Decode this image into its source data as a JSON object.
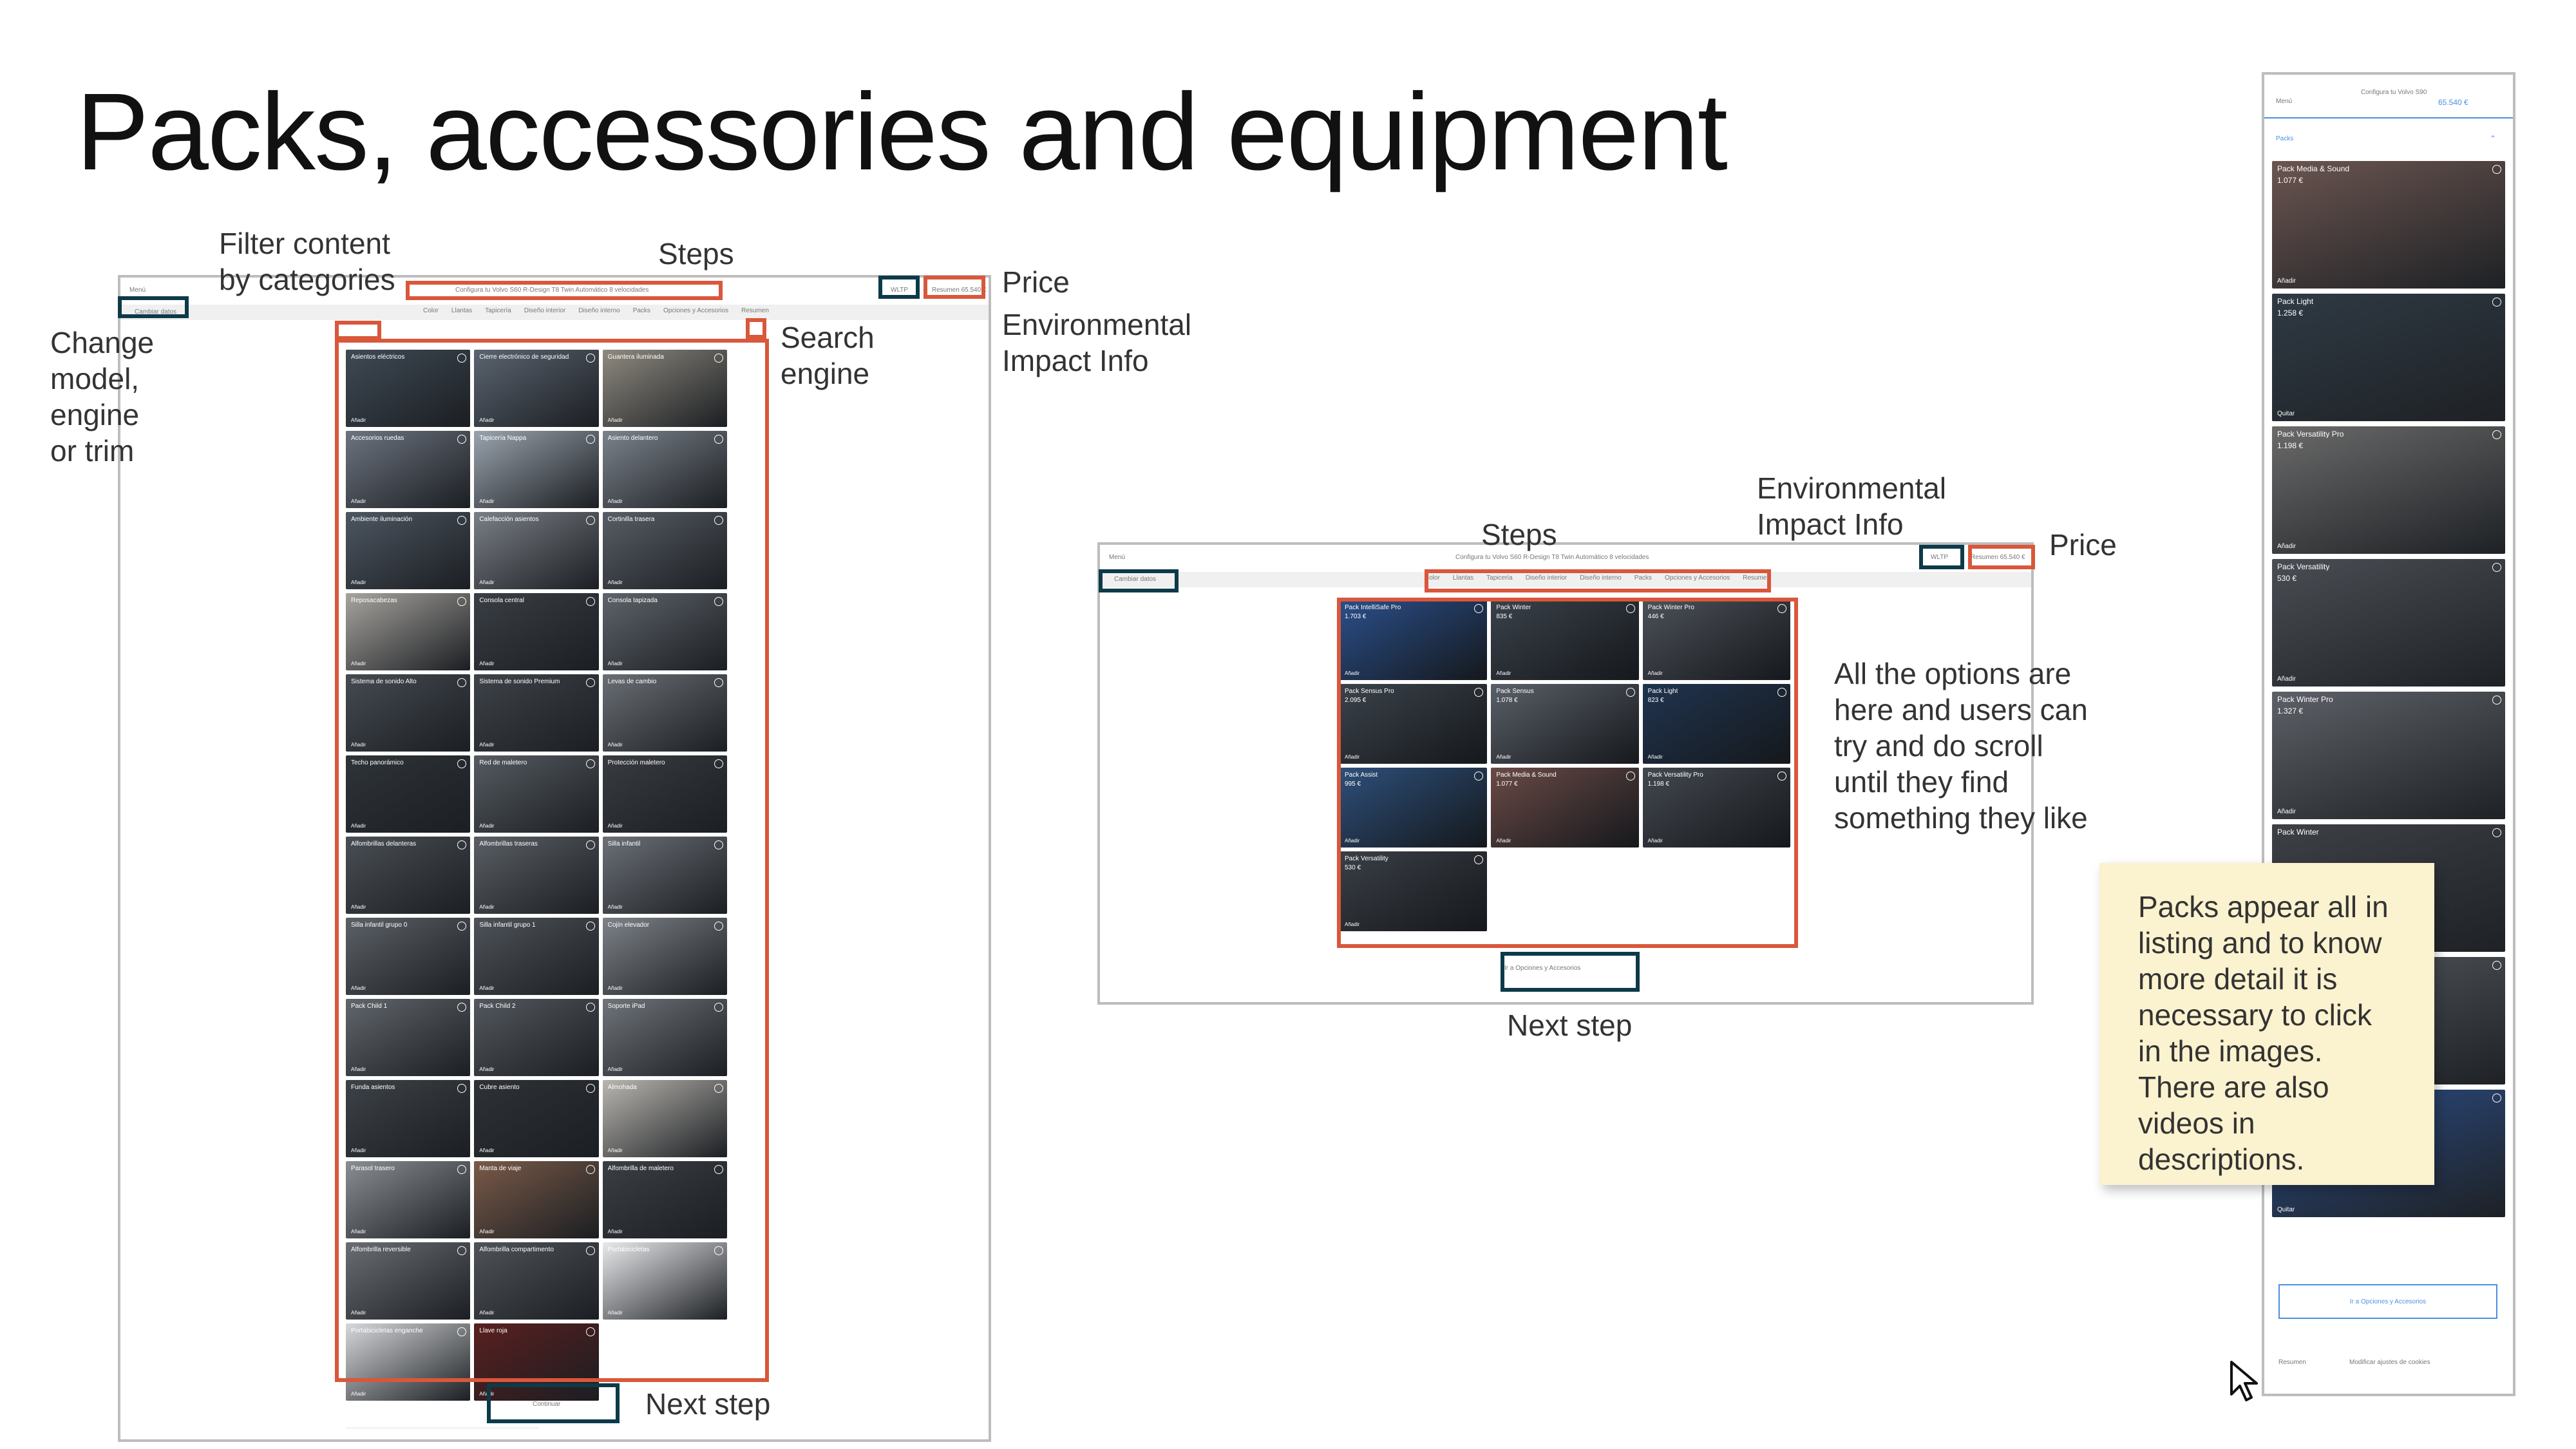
{
  "slide_title": "Packs, accessories and equipment",
  "annotations": {
    "filter": "Filter content\nby categories",
    "steps_left": "Steps",
    "price_left": "Price",
    "env_left": "Environmental\nImpact Info",
    "change_model": "Change\nmodel,\nengine\nor trim",
    "search": "Search\nengine",
    "next_left": "Next step",
    "steps_mid": "Steps",
    "env_mid": "Environmental\nImpact Info",
    "price_mid": "Price",
    "options_note": "All the options are\nhere and users can\ntry and do scroll\nuntil they find\nsomething they like",
    "next_mid": "Next step"
  },
  "sticky_note": "Packs appear all in listing and to know more detail it is necessary to click in the images. There are also videos in descriptions.",
  "desktop_left": {
    "header_menu": "Menú",
    "header_title": "Configura tu Volvo S60 R-Design T8 Twin Automático 8 velocidades",
    "model_button": "Cambiar datos",
    "steps": [
      "Color",
      "Llantas",
      "Tapicería",
      "Diseño interior",
      "Diseño interno",
      "Packs",
      "Opciones y Accesorios",
      "Resumen"
    ],
    "env_button": "WLTP",
    "price_button": "Resumen 65.540 €",
    "next_button": "Continuar",
    "add_label": "Añadir",
    "tiles": [
      {
        "name": "Asientos eléctricos",
        "color": "#3f4a55"
      },
      {
        "name": "Cierre electrónico de seguridad",
        "color": "#5b6470"
      },
      {
        "name": "Guantera iluminada",
        "color": "#8f8a80"
      },
      {
        "name": "Accesorios ruedas",
        "color": "#6d7480"
      },
      {
        "name": "Tapicería Nappa",
        "color": "#9aa3ad"
      },
      {
        "name": "Asiento delantero",
        "color": "#7c838c"
      },
      {
        "name": "Ambiente iluminación",
        "color": "#4d5661"
      },
      {
        "name": "Calefacción asientos",
        "color": "#7a7f86"
      },
      {
        "name": "Cortinilla trasera",
        "color": "#585e66"
      },
      {
        "name": "Reposacabezas",
        "color": "#a7a49f"
      },
      {
        "name": "Consola central",
        "color": "#3a3f45"
      },
      {
        "name": "Consola tapizada",
        "color": "#5e646b"
      },
      {
        "name": "Sistema de sonido Alto",
        "color": "#454b52"
      },
      {
        "name": "Sistema de sonido Premium",
        "color": "#3e4349"
      },
      {
        "name": "Levas de cambio",
        "color": "#6a6f75"
      },
      {
        "name": "Techo panorámico",
        "color": "#2f3439"
      },
      {
        "name": "Red de maletero",
        "color": "#555b61"
      },
      {
        "name": "Protección maletero",
        "color": "#383c41"
      },
      {
        "name": "Alfombrillas delanteras",
        "color": "#4a4f55"
      },
      {
        "name": "Alfombrillas traseras",
        "color": "#5a5f65"
      },
      {
        "name": "Silla infantil",
        "color": "#6b7077"
      },
      {
        "name": "Silla infantil grupo 0",
        "color": "#5c6167"
      },
      {
        "name": "Silla infantil grupo 1",
        "color": "#4e5359"
      },
      {
        "name": "Cojín elevador",
        "color": "#7d8288"
      },
      {
        "name": "Pack Child 1",
        "color": "#61666c"
      },
      {
        "name": "Pack Child 2",
        "color": "#53585e"
      },
      {
        "name": "Soporte iPad",
        "color": "#6f747a"
      },
      {
        "name": "Funda asientos",
        "color": "#3d4248"
      },
      {
        "name": "Cubre asiento",
        "color": "#2e3237"
      },
      {
        "name": "Almohada",
        "color": "#b9b6b0"
      },
      {
        "name": "Parasol trasero",
        "color": "#8a8e93"
      },
      {
        "name": "Manta de viaje",
        "color": "#7a5a48"
      },
      {
        "name": "Alfombrilla de maletero",
        "color": "#3b3f44"
      },
      {
        "name": "Alfombrilla reversible",
        "color": "#6a6e73"
      },
      {
        "name": "Alfombrilla compartimento",
        "color": "#4f5358"
      },
      {
        "name": "Portabicicletas",
        "color": "#e9eaec"
      },
      {
        "name": "Portabicicletas enganche",
        "color": "#d6d8db"
      },
      {
        "name": "Llave roja",
        "color": "#5a1f1f"
      }
    ]
  },
  "desktop_mid": {
    "header_menu": "Menú",
    "header_title": "Configura tu Volvo S60 R-Design T8 Twin Automático 8 velocidades",
    "model_button": "Cambiar datos",
    "steps": [
      "Color",
      "Llantas",
      "Tapicería",
      "Diseño interior",
      "Diseño interno",
      "Packs",
      "Opciones y Accesorios",
      "Resumen"
    ],
    "env_button": "WLTP",
    "price_button": "Resumen 65.540 €",
    "next_button": "Ir a Opciones y Accesorios",
    "add_label": "Añadir",
    "tiles": [
      {
        "name": "Pack IntelliSafe Pro",
        "price": "1.703 €",
        "color": "#2a4f8a"
      },
      {
        "name": "Pack Winter",
        "price": "835 €",
        "color": "#3a4149"
      },
      {
        "name": "Pack Winter Pro",
        "price": "446 €",
        "color": "#4c5158"
      },
      {
        "name": "Pack Sensus Pro",
        "price": "2.095 €",
        "color": "#3b424a"
      },
      {
        "name": "Pack Sensus",
        "price": "1.078 €",
        "color": "#5a6068"
      },
      {
        "name": "Pack Light",
        "price": "823 €",
        "color": "#20344f"
      },
      {
        "name": "Pack Assist",
        "price": "995 €",
        "color": "#2d4f7a"
      },
      {
        "name": "Pack Media & Sound",
        "price": "1.077 €",
        "color": "#6a4a46"
      },
      {
        "name": "Pack Versatility Pro",
        "price": "1.198 €",
        "color": "#43484f"
      },
      {
        "name": "Pack Versatility",
        "price": "530 €",
        "color": "#3a3f46"
      }
    ]
  },
  "mobile": {
    "menu": "Menú",
    "title": "Configura tu Volvo S90",
    "price": "65.540 €",
    "category": "Packs",
    "add_label": "Añadir",
    "remove_label": "Quitar",
    "next_button": "Ir a Opciones y Accesorios",
    "footer_left": "Resumen",
    "footer_right": "Modificar ajustes de cookies",
    "cards": [
      {
        "name": "Pack Media & Sound",
        "price": "1.077 €",
        "color": "#6b5550",
        "action": "Añadir"
      },
      {
        "name": "Pack Light",
        "price": "1.258 €",
        "color": "#2f3a44",
        "action": "Quitar"
      },
      {
        "name": "Pack Versatility Pro",
        "price": "1.198 €",
        "color": "#6a6a6a",
        "action": "Añadir"
      },
      {
        "name": "Pack Versatility",
        "price": "530 €",
        "color": "#4a4e54",
        "action": "Añadir"
      },
      {
        "name": "Pack Winter Pro",
        "price": "1.327 €",
        "color": "#5d6167",
        "action": "Añadir"
      },
      {
        "name": "Pack Winter",
        "price": "",
        "color": "#3d4146",
        "action": "Añadir"
      },
      {
        "name": "",
        "price": "",
        "color": "#54585e",
        "action": ""
      },
      {
        "name": "",
        "price": "",
        "color": "#2b4d86",
        "action": "Quitar"
      }
    ]
  },
  "colors": {
    "orange": "#d9573b",
    "navy": "#0d3a4a",
    "note": "#fbf2cf",
    "mobile_accent": "#4a90e2"
  }
}
